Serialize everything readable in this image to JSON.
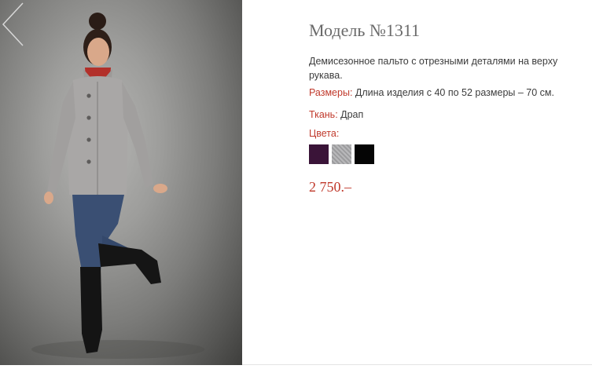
{
  "product": {
    "title": "Модель №1311",
    "description": "Демисезонное пальто  с отрезными деталями на верху рукава.",
    "sizes_label": "Размеры:",
    "sizes_value": " Длина изделия с 40 по 52 размеры – 70 см.",
    "fabric_label": "Ткань:",
    "fabric_value": " Драп",
    "colors_label": "Цвета:",
    "price": "2 750.–"
  },
  "colors": {
    "accent": "#c0392b",
    "swatch_purple": "#3a1438",
    "swatch_grey": "#a9a9ab",
    "swatch_black": "#050505"
  },
  "icons": {
    "prev": "chevron-left-icon"
  }
}
